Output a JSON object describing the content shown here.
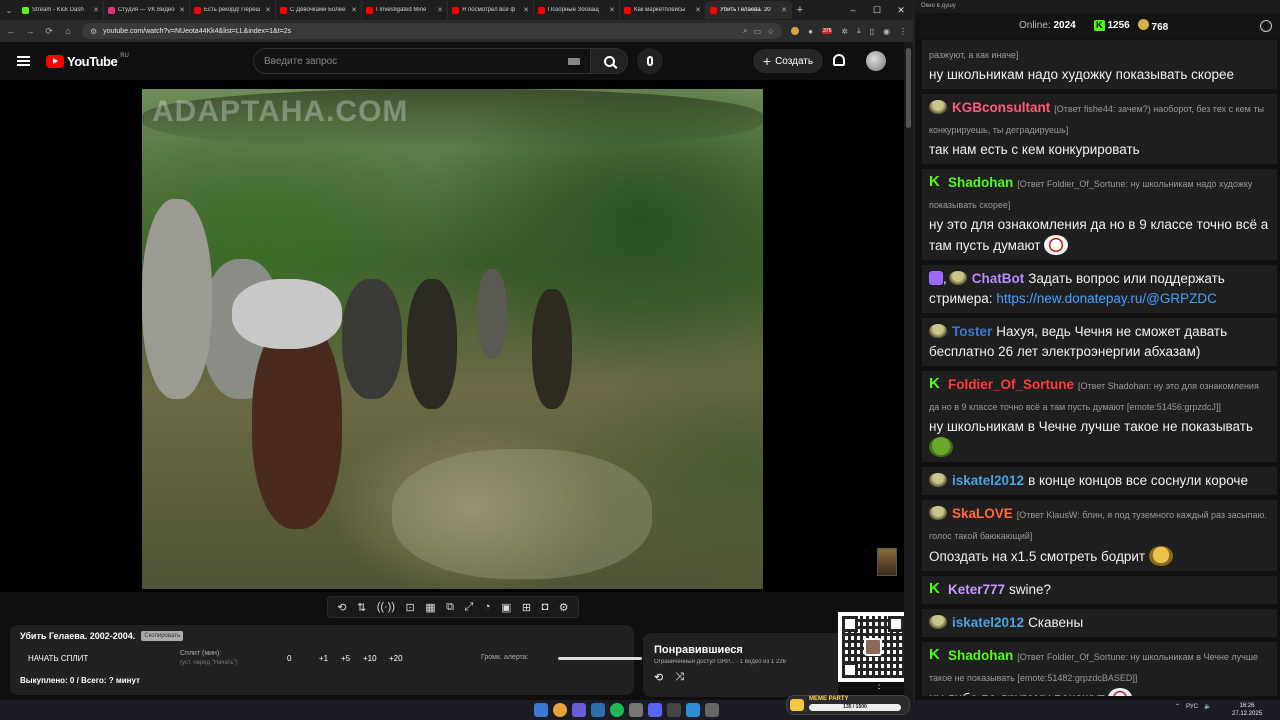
{
  "browser": {
    "tabs": [
      {
        "label": "Stream - Kick Dash",
        "color": "#53fc18"
      },
      {
        "label": "Студия — VK Видео",
        "color": "#e0307a"
      },
      {
        "label": "Есть рекорд! Переш",
        "color": "#ff0000"
      },
      {
        "label": "С Девочками Более",
        "color": "#ff0000"
      },
      {
        "label": "I Investigated Mine",
        "color": "#ff0000"
      },
      {
        "label": "Я посмотрел все ф",
        "color": "#ff0000"
      },
      {
        "label": "Позорные Зоозащ",
        "color": "#ff0000"
      },
      {
        "label": "Как маркетплейсы",
        "color": "#ff0000"
      },
      {
        "label": "Убить Гелаева. 20",
        "color": "#ff0000",
        "active": true
      }
    ],
    "url": "youtube.com/watch?v=NUeota44Kk4&list=LL&index=1&t=2s",
    "ext_badge": "375"
  },
  "youtube": {
    "logo_text": "YouTube",
    "logo_region": "RU",
    "search_placeholder": "Введите запрос",
    "create_label": "Создать"
  },
  "video": {
    "watermark": "ADAPTAHA.COM",
    "title": "Убить Гелаева. 2002-2004.",
    "copy_label": "Скопировать"
  },
  "split": {
    "button_label": "НАЧАТЬ СПЛИТ",
    "field_label": "Сплит (мин):",
    "field_hint": "(уст. перед \"Начать\")",
    "value": "0",
    "increments": [
      "+1",
      "+5",
      "+10",
      "+20"
    ],
    "alert_label": "Громк. алерта:",
    "bought_text": "Выкуплено: 0 / Всего: ? минут"
  },
  "liked": {
    "title": "Понравившиеся",
    "subtitle": "Ограниченный доступ  GRP...  · 1 видео из 1 226"
  },
  "chat": {
    "window_title": "Окно в душу",
    "online_label": "Online:",
    "online_count": "2024",
    "kick_count": "1256",
    "coin_count": "768",
    "messages": [
      {
        "badge": "none",
        "user": "",
        "user_color": "#fff",
        "reply": "разжуют, а как иначе]",
        "text": "ну школьникам надо художку показывать скорее",
        "emote": ""
      },
      {
        "badge": "frog",
        "user": "KGBconsultant",
        "user_color": "#ff5a7a",
        "reply": "[Ответ fishe44: зачем?) наоборот, без тех с кем ты конкурируешь, ты деградируешь]",
        "text": "так нам есть с кем конкурировать",
        "emote": ""
      },
      {
        "badge": "kick",
        "user": "Shadohan",
        "user_color": "#53fc18",
        "reply": "[Ответ Foldier_Of_Sortune: ну школьникам надо художку показывать скорее]",
        "text": "ну это для ознакомления да но в 9 классе точно всё а там пусть думают",
        "emote": "clown"
      },
      {
        "badge": "bot",
        "user": "ChatBot",
        "user_color": "#b68cff",
        "reply": "",
        "text": "Задать вопрос или поддержать стримера:",
        "link": "https://new.donatepay.ru/@GRPZDC",
        "emote": ""
      },
      {
        "badge": "frog",
        "user": "Toster",
        "user_color": "#3a7bd5",
        "reply": "",
        "text": "Нахуя, ведь Чечня не сможет давать бесплатно 26 лет электроэнергии абхазам)",
        "emote": ""
      },
      {
        "badge": "kick",
        "user": "Foldier_Of_Sortune",
        "user_color": "#ff3b3b",
        "reply": "[Ответ Shadohan: ну это для ознакомления да но в 9 классе точно всё а там пусть думают [emote:51456:grpzdcJ]]",
        "text": "ну школьникам в Чечне лучше такое не показывать",
        "emote": "pepe"
      },
      {
        "badge": "frog",
        "user": "iskatel2012",
        "user_color": "#4aa3e0",
        "reply": "",
        "text": "в конце концов все соснули короче",
        "emote": ""
      },
      {
        "badge": "frog",
        "user": "SkaLOVE",
        "user_color": "#ff6a3a",
        "reply": "[Ответ KlausW: блин, я под туземного каждый раз засыпаю. голос такой баюкающий]",
        "text": "Опоздать на x1.5 смотреть бодрит",
        "emote": "dog"
      },
      {
        "badge": "kick",
        "user": "Keter777",
        "user_color": "#c89bff",
        "reply": "",
        "text": "swine?",
        "emote": ""
      },
      {
        "badge": "frog",
        "user": "iskatel2012",
        "user_color": "#4aa3e0",
        "reply": "",
        "text": "Скавены",
        "emote": ""
      },
      {
        "badge": "kick",
        "user": "Shadohan",
        "user_color": "#53fc18",
        "reply": "[Ответ Foldier_Of_Sortune: ну школьникам в Чечне лучше такое не показывать [emote:51482:grpzdcBASED]]",
        "text": "ну либо по другому покажут",
        "emote": "clown"
      }
    ]
  },
  "overlay": {
    "meme_party_title": "MEME PARTY",
    "meme_party_progress": "135 / 1500"
  },
  "taskbar": {
    "lang": "РУС",
    "time": "16:26",
    "date": "27.12.2025"
  }
}
